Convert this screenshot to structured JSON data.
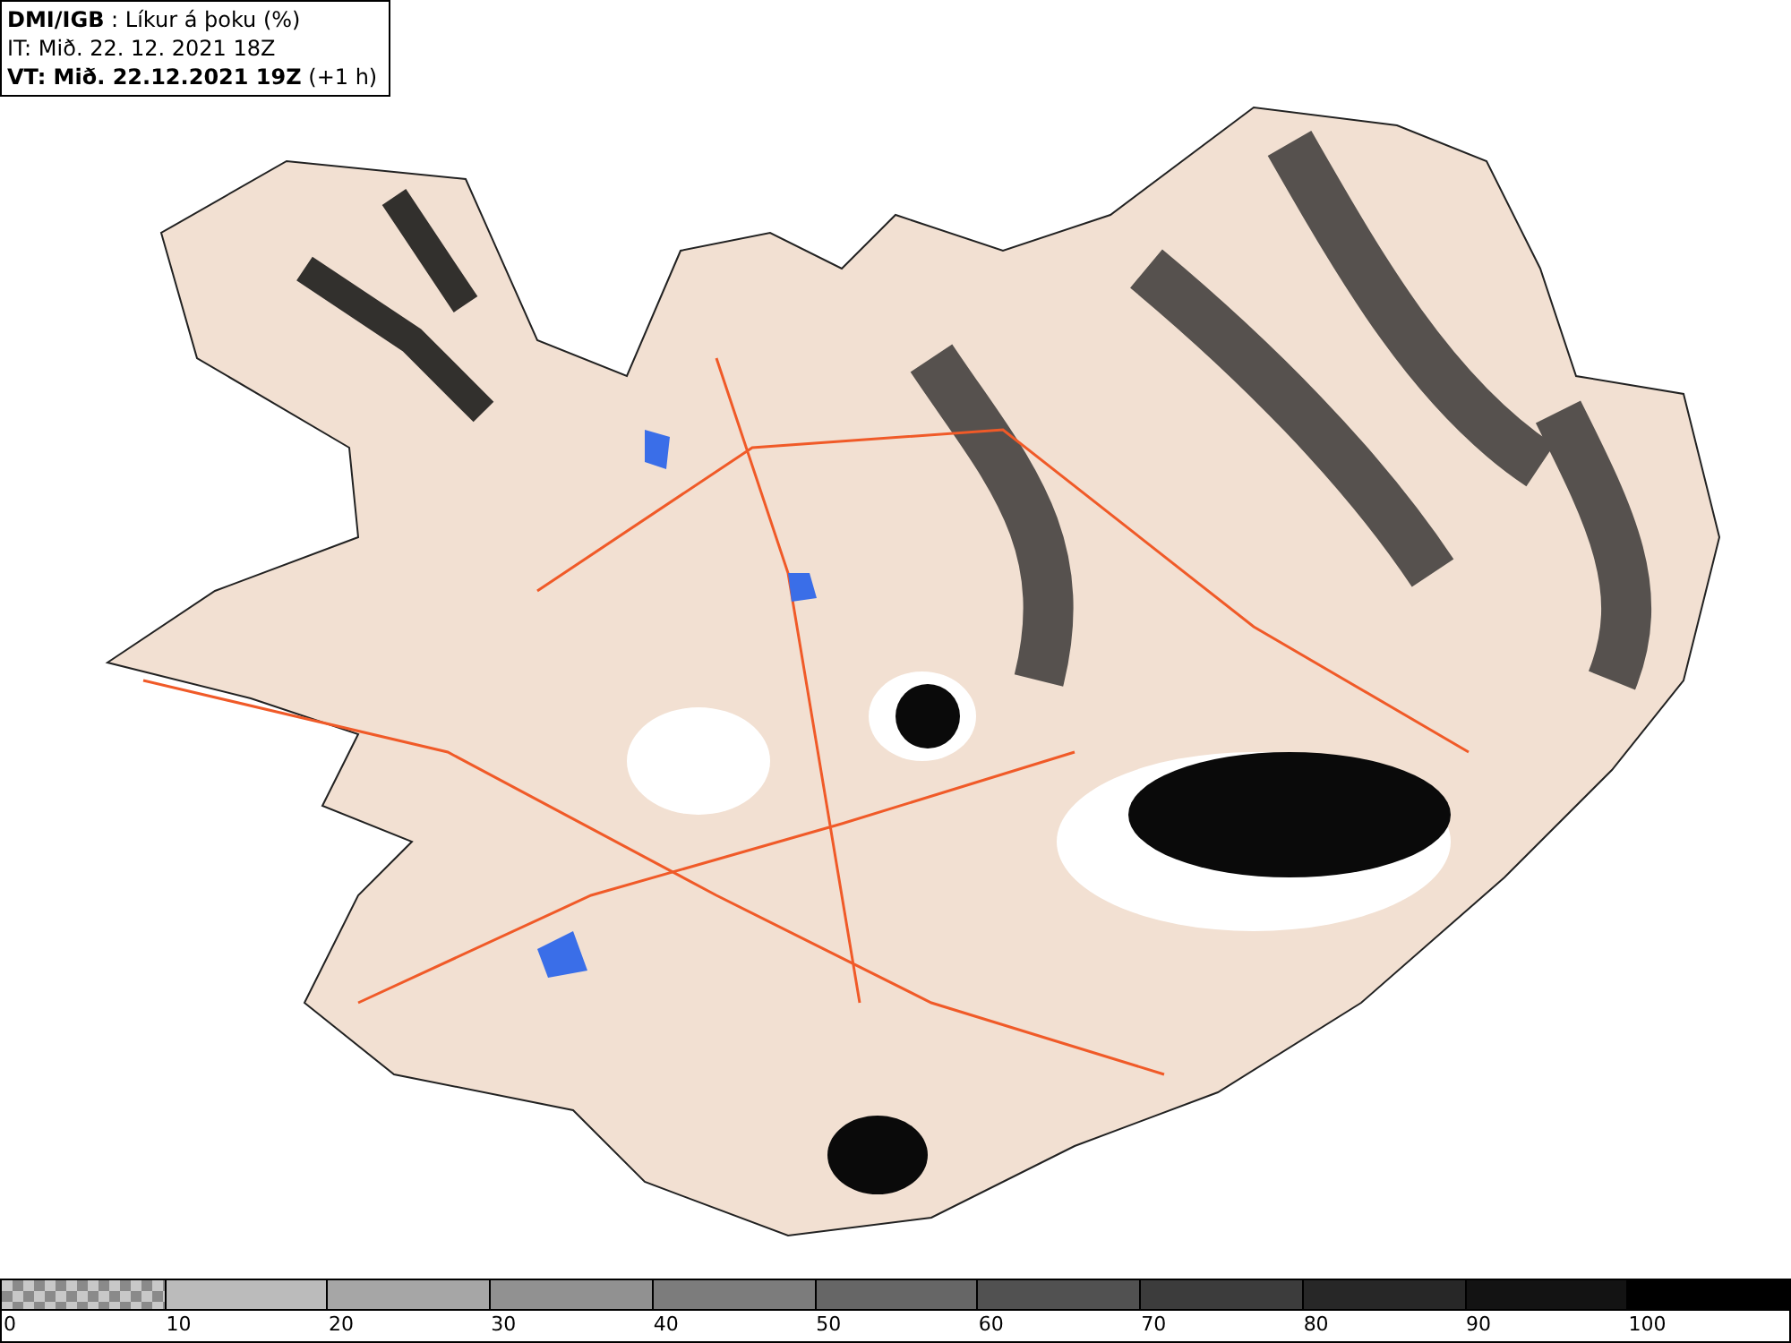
{
  "legend": {
    "lines": [
      "**DMI/IGB** : Líkur á þoku (%)",
      "IT: Mið. 22. 12. 2021 18Z",
      "**VT: Mið. 22.12.2021 19Z** (+1 h)"
    ]
  },
  "colorbar": {
    "segments": [
      {
        "kind": "checker",
        "color": "#8a8a8a"
      },
      {
        "kind": "solid",
        "color": "#bbbbbb"
      },
      {
        "kind": "solid",
        "color": "#a6a6a6"
      },
      {
        "kind": "solid",
        "color": "#919191"
      },
      {
        "kind": "solid",
        "color": "#7c7c7c"
      },
      {
        "kind": "solid",
        "color": "#666666"
      },
      {
        "kind": "solid",
        "color": "#515151"
      },
      {
        "kind": "solid",
        "color": "#3c3c3c"
      },
      {
        "kind": "solid",
        "color": "#272727"
      },
      {
        "kind": "solid",
        "color": "#131313"
      },
      {
        "kind": "solid",
        "color": "#000000"
      }
    ],
    "ticks": [
      "0",
      "10",
      "20",
      "30",
      "40",
      "50",
      "60",
      "70",
      "80",
      "90",
      "100"
    ]
  }
}
